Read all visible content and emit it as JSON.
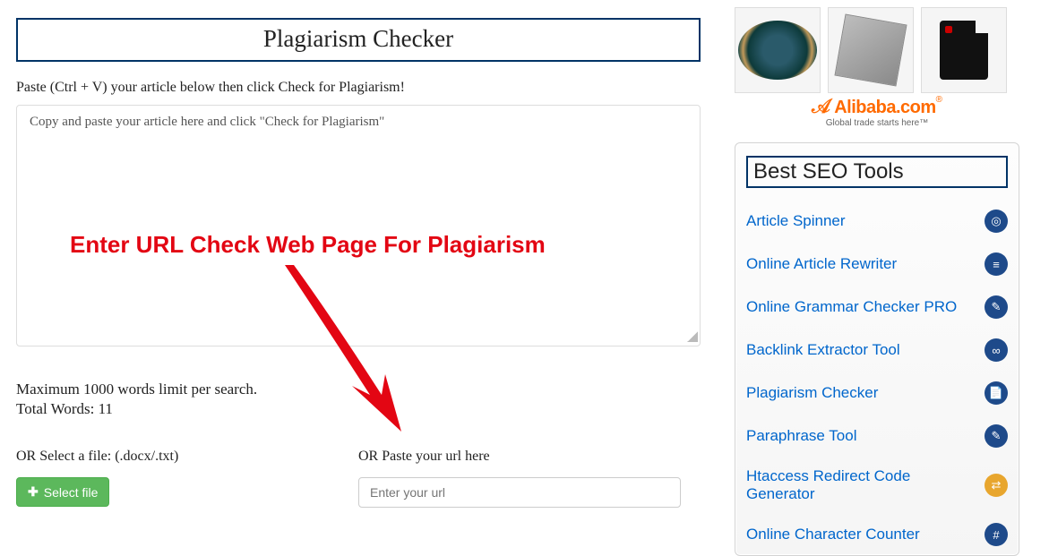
{
  "main": {
    "title": "Plagiarism Checker",
    "instructions": "Paste (Ctrl + V) your article below then click Check for Plagiarism!",
    "textarea_value": "Copy and paste your article here and click \"Check for Plagiarism\"",
    "overlay_annotation": "Enter URL Check Web Page For Plagiarism",
    "limit": "Maximum 1000 words limit per search.",
    "word_count": "Total Words: 11",
    "file_label": "OR Select a file: (.docx/.txt)",
    "select_file_btn": "Select file",
    "url_label": "OR Paste your url here",
    "url_placeholder": "Enter your url"
  },
  "sidebar": {
    "alibaba_main": "Alibaba",
    "alibaba_dotcom": ".com",
    "alibaba_tag": "Global trade starts here",
    "tools_title": "Best SEO Tools",
    "tools": [
      {
        "label": "Article Spinner"
      },
      {
        "label": "Online Article Rewriter"
      },
      {
        "label": "Online Grammar Checker PRO"
      },
      {
        "label": "Backlink Extractor Tool"
      },
      {
        "label": "Plagiarism Checker"
      },
      {
        "label": "Paraphrase Tool"
      },
      {
        "label": "Htaccess Redirect Code Generator"
      },
      {
        "label": "Online Character Counter"
      }
    ]
  }
}
